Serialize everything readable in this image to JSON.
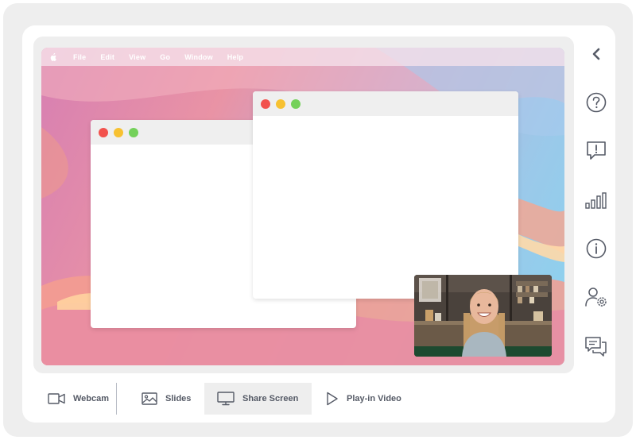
{
  "desktop": {
    "menubar": {
      "items": [
        "File",
        "Edit",
        "View",
        "Go",
        "Window",
        "Help"
      ]
    }
  },
  "toolbar": {
    "buttons": [
      {
        "label": "Webcam",
        "icon": "video-camera-icon"
      },
      {
        "label": "Slides",
        "icon": "image-icon"
      },
      {
        "label": "Share Screen",
        "icon": "monitor-icon",
        "active": true
      },
      {
        "label": "Play-in Video",
        "icon": "play-icon"
      }
    ]
  },
  "sidebar": {
    "icons": [
      "chevron-left-icon",
      "help-icon",
      "feedback-icon",
      "bar-chart-icon",
      "info-icon",
      "user-settings-icon",
      "chat-icon"
    ]
  },
  "colors": {
    "frame": "#eeeeee",
    "active_tool": "#eeeeee",
    "toolbar_text": "#555a66",
    "icon_stroke": "#555a66"
  }
}
